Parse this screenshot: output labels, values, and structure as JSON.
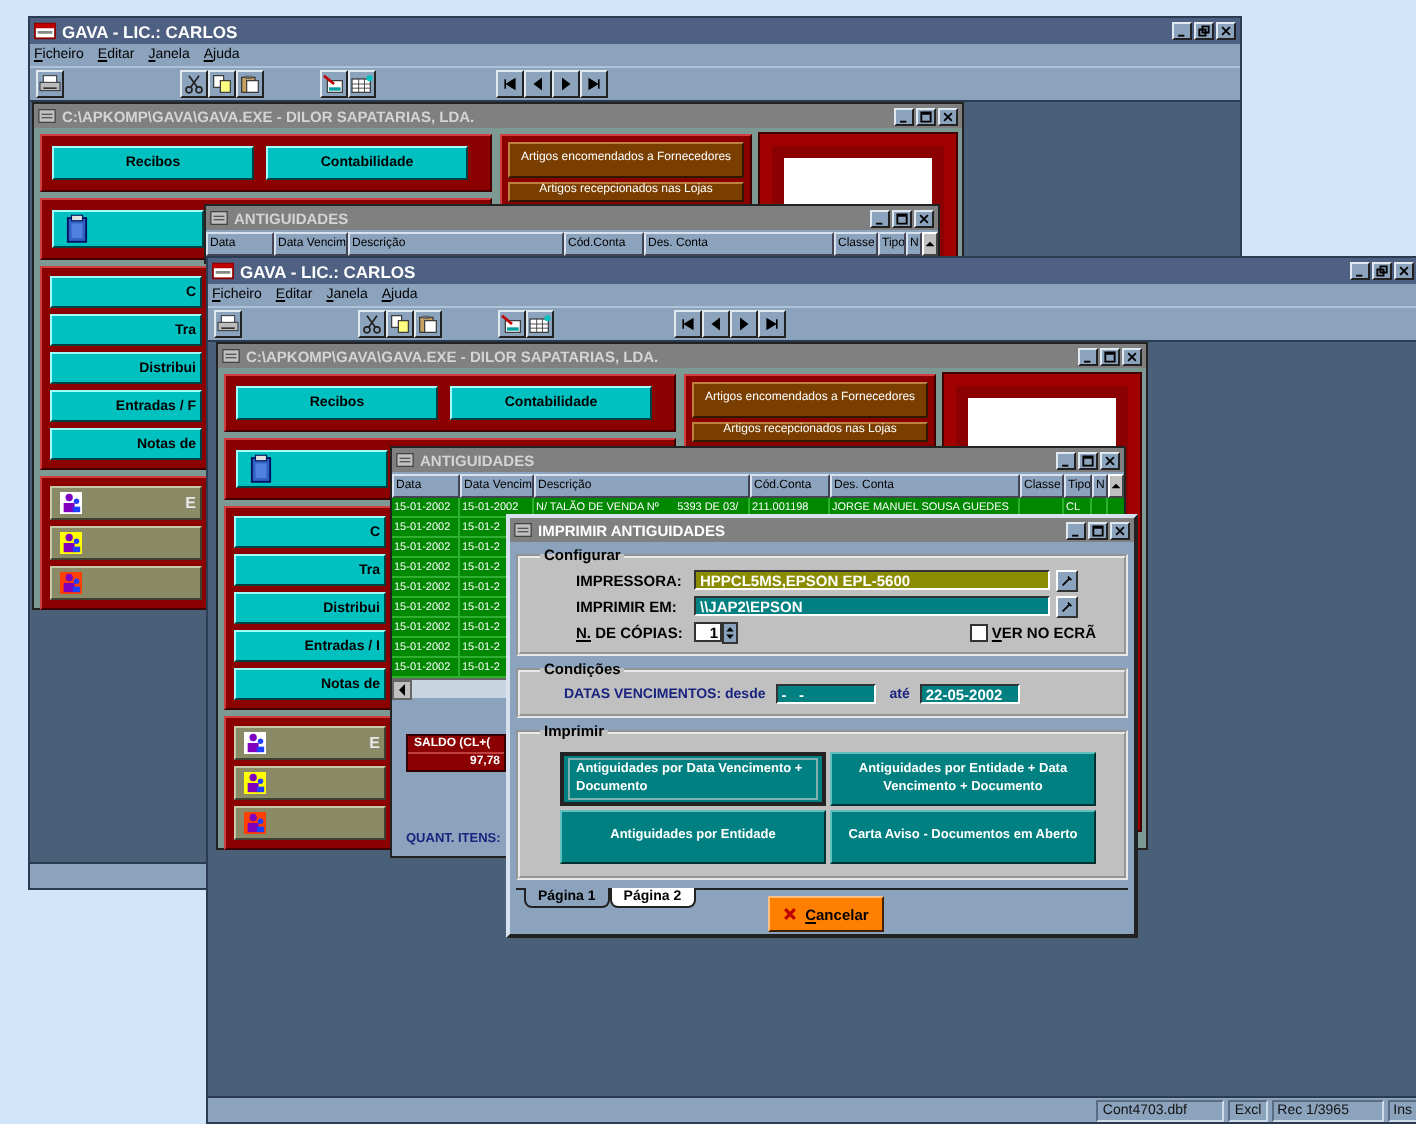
{
  "app_windows": [
    {
      "title": "GAVA - LIC.: CARLOS",
      "menu": [
        "Ficheiro",
        "Editar",
        "Janela",
        "Ajuda"
      ],
      "document": {
        "title": "C:\\APKOMP\\GAVA\\GAVA.EXE - DILOR SAPATARIAS, LDA.",
        "top_buttons": [
          "Recibos",
          "Contabilidade"
        ],
        "side_buttons": [
          "C",
          "Tra",
          "Distribui",
          "Entradas / F",
          "Notas de"
        ],
        "lower_buttons": [
          {
            "label": "E",
            "color": "#ffffff"
          },
          {
            "color": "#ffff00"
          },
          {
            "color": "#ff4000"
          }
        ],
        "article_buttons": [
          "Artigos encomendados a Fornecedores",
          "Artigos recepcionados nas Lojas"
        ]
      },
      "list_window": {
        "title": "ANTIGUIDADES",
        "columns": [
          "Data",
          "Data Vencim",
          "Descrição",
          "Cód.Conta",
          "Des. Conta",
          "Classe",
          "Tipo",
          "N"
        ]
      }
    },
    {
      "title": "GAVA - LIC.: CARLOS",
      "menu": [
        "Ficheiro",
        "Editar",
        "Janela",
        "Ajuda"
      ],
      "document": {
        "title": "C:\\APKOMP\\GAVA\\GAVA.EXE - DILOR SAPATARIAS, LDA.",
        "top_buttons": [
          "Recibos",
          "Contabilidade"
        ],
        "side_buttons": [
          "C",
          "Tra",
          "Distribui",
          "Entradas / I",
          "Notas de"
        ],
        "lower_buttons": [
          {
            "label": "E",
            "color": "#ffffff"
          },
          {
            "color": "#ffff00"
          },
          {
            "color": "#ff4000"
          }
        ],
        "article_buttons": [
          "Artigos encomendados a Fornecedores",
          "Artigos recepcionados nas Lojas"
        ]
      },
      "list_window": {
        "title": "ANTIGUIDADES",
        "columns": [
          "Data",
          "Data Vencim",
          "Descrição",
          "Cód.Conta",
          "Des. Conta",
          "Classe",
          "Tipo",
          "N"
        ],
        "rows": [
          {
            "date": "15-01-2002",
            "due": "15-01-2002",
            "description": "N/ TALÃO DE VENDA Nº      5393 DE 03/",
            "account": "211.001198",
            "account_name": "JORGE MANUEL SOUSA GUEDES",
            "type": "CL"
          },
          {
            "date": "15-01-2002",
            "due": "15-01-2"
          },
          {
            "date": "15-01-2002",
            "due": "15-01-2"
          },
          {
            "date": "15-01-2002",
            "due": "15-01-2"
          },
          {
            "date": "15-01-2002",
            "due": "15-01-2"
          },
          {
            "date": "15-01-2002",
            "due": "15-01-2"
          },
          {
            "date": "15-01-2002",
            "due": "15-01-2"
          },
          {
            "date": "15-01-2002",
            "due": "15-01-2"
          },
          {
            "date": "15-01-2002",
            "due": "15-01-2"
          }
        ],
        "saldo_label": "SALDO (CL+(",
        "saldo_value": "97,78",
        "quant_label": "QUANT. ITENS:"
      },
      "dialog": {
        "title": "IMPRIMIR ANTIGUIDADES",
        "configurar": {
          "legend": "Configurar",
          "printer_label": "IMPRESSORA:",
          "printer": "HPPCL5MS,EPSON EPL-5600",
          "output_label": "IMPRIMIR EM:",
          "output": "\\\\JAP2\\EPSON",
          "copies_label": "N. DE CÓPIAS:",
          "copies": "1",
          "preview": {
            "label": "VER NO ECRÃ",
            "checked": false
          }
        },
        "condicoes": {
          "legend": "Condições",
          "dates_label": "DATAS VENCIMENTOS: desde",
          "from": "-   -",
          "to_label": "até",
          "to": "22-05-2002"
        },
        "imprimir": {
          "legend": "Imprimir",
          "buttons": [
            {
              "label": "Antiguidades por Data Vencimento + Documento",
              "focused": true
            },
            {
              "label": "Antiguidades por Entidade + Data Vencimento + Documento",
              "focused": false
            },
            {
              "label": "Antiguidades por Entidade",
              "focused": false
            },
            {
              "label": "Carta Aviso - Documentos em Aberto",
              "focused": false
            }
          ]
        },
        "tabs": [
          {
            "label": "Página 1",
            "selected": true
          },
          {
            "label": "Página 2",
            "selected": false
          }
        ],
        "cancel": "Cancelar"
      },
      "status_bar": [
        "Cont4703.dbf",
        "Excl",
        "Rec 1/3965",
        "Ins"
      ]
    }
  ]
}
